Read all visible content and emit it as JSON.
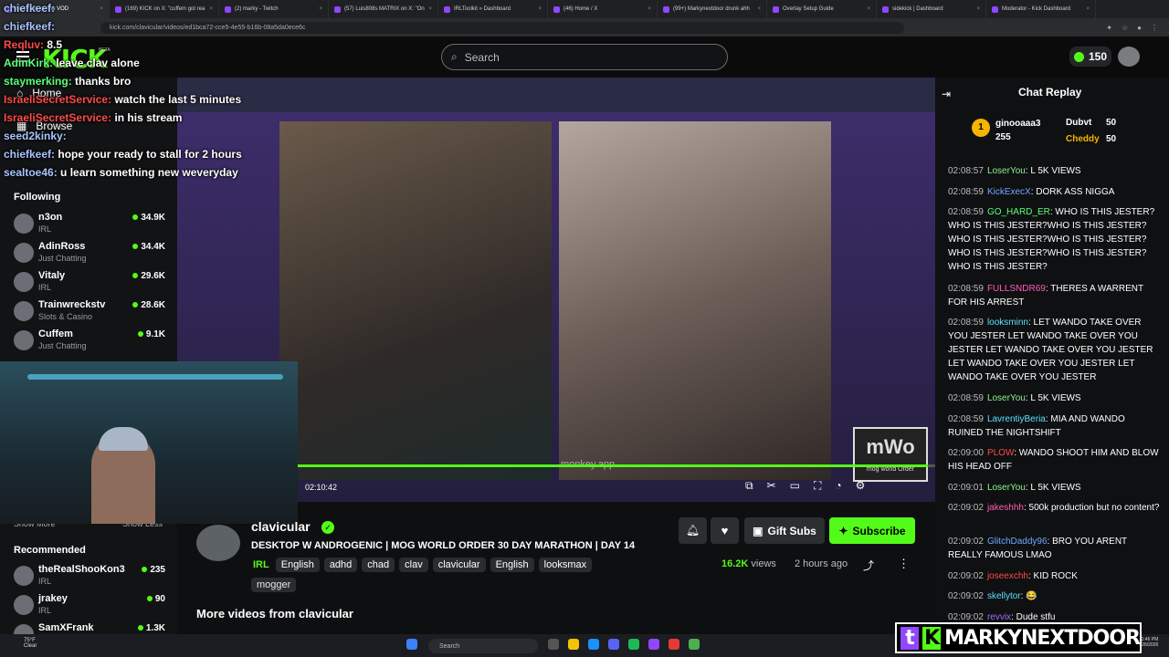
{
  "browser": {
    "tabs": [
      {
        "label": "Kick - Watch the VOD"
      },
      {
        "label": "(169) KICK on X: \"cuffem got rea"
      },
      {
        "label": "(2) marky - Twitch"
      },
      {
        "label": "(57) Luis808s MATRIX on X: \"On"
      },
      {
        "label": "IRLToolkit » Dashboard"
      },
      {
        "label": "(46) Home / X"
      },
      {
        "label": "(99+) Markynextdoor drunk ahh"
      },
      {
        "label": "Overlay Setup Guide"
      },
      {
        "label": "sidekick | Dashboard"
      },
      {
        "label": "Moderator - Kick Dashboard"
      }
    ],
    "url": "kick.com/clavicular/videos/ed1bca72-cce5-4e55-b16b-08a5da0ece6c"
  },
  "header": {
    "logo": "KICK",
    "beta": "BETA",
    "search_placeholder": "Search",
    "coins": "150"
  },
  "sidebar": {
    "home": "Home",
    "browse": "Browse",
    "following_title": "Following",
    "following": [
      {
        "name": "n3on",
        "category": "IRL",
        "viewers": "34.9K"
      },
      {
        "name": "AdinRoss",
        "category": "Just Chatting",
        "viewers": "34.4K"
      },
      {
        "name": "Vitaly",
        "category": "IRL",
        "viewers": "29.6K"
      },
      {
        "name": "Trainwreckstv",
        "category": "Slots & Casino",
        "viewers": "28.6K"
      },
      {
        "name": "Cuffem",
        "category": "Just Chatting",
        "viewers": "9.1K"
      }
    ],
    "show_more": "Show More",
    "show_less": "Show Less",
    "recommended_title": "Recommended",
    "recommended": [
      {
        "name": "theRealShooKon3",
        "category": "IRL",
        "viewers": "235"
      },
      {
        "name": "jrakey",
        "category": "IRL",
        "viewers": "90"
      },
      {
        "name": "SamXFrank",
        "category": "",
        "viewers": "1.3K"
      }
    ]
  },
  "overlay_chat": [
    {
      "user": "chiefkeef:",
      "text": ""
    },
    {
      "user": "chiefkeef:",
      "text": ""
    },
    {
      "user": "Reqluv:",
      "text": "8.5"
    },
    {
      "user": "AdinKirk:",
      "text": "leave clav alone"
    },
    {
      "user": "staymerking:",
      "text": "thanks bro"
    },
    {
      "user": "IsraeliSecretService:",
      "text": "watch the last 5 minutes"
    },
    {
      "user": "IsraeliSecretService:",
      "text": "in his stream"
    },
    {
      "user": "seed2kinky:",
      "text": ""
    },
    {
      "user": "chiefkeef:",
      "text": "hope your ready to stall for 2 hours"
    },
    {
      "user": "sealtoe46:",
      "text": "u learn something new weveryday"
    }
  ],
  "player": {
    "timecode": "02:10:42",
    "overlay_text": "monkey.app",
    "mog_logo": "mWo",
    "mog_sub": "mog world Order",
    "progress_fraction": 0.98
  },
  "video": {
    "channel": "clavicular",
    "title": "DESKTOP W ANDROGENIC | MOG WORLD ORDER 30 DAY MARATHON | DAY 14",
    "category": "IRL",
    "tags": [
      "English",
      "adhd",
      "chad",
      "clav",
      "clavicular",
      "English",
      "looksmax",
      "mogger"
    ],
    "views_count": "16.2K",
    "views_label": "views",
    "ago": "2 hours ago",
    "gift_subs": "Gift Subs",
    "subscribe": "Subscribe",
    "more_videos": "More videos from clavicular"
  },
  "chat": {
    "title": "Chat Replay",
    "leaderboard": [
      {
        "rank": "1",
        "name": "ginooaaa3",
        "value": "255"
      },
      {
        "rank": "",
        "name": "Dubvt",
        "value": "50"
      },
      {
        "rank": "",
        "name": "Cheddy",
        "value": "50"
      }
    ],
    "messages": [
      {
        "time": "02:08:57",
        "user": "LoserYou",
        "color": "#8af58a",
        "text": "L 5K VIEWS"
      },
      {
        "time": "02:08:59",
        "user": "KickExecX",
        "color": "#6fa8ff",
        "text": "DORK ASS NIGGA"
      },
      {
        "time": "02:08:59",
        "user": "GO_HARD_ER",
        "color": "#5dff7a",
        "text": "WHO IS THIS JESTER? WHO IS THIS JESTER?WHO IS THIS JESTER? WHO IS THIS JESTER?WHO IS THIS JESTER? WHO IS THIS JESTER?WHO IS THIS JESTER? WHO IS THIS JESTER?"
      },
      {
        "time": "02:08:59",
        "user": "FULLSNDR69",
        "color": "#ff5cb8",
        "text": "THERES A WARRENT FOR HIS ARREST"
      },
      {
        "time": "02:08:59",
        "user": "looksminn",
        "color": "#5ee0ff",
        "text": "LET WANDO TAKE OVER YOU JESTER LET WANDO TAKE OVER YOU JESTER LET WANDO TAKE OVER YOU JESTER LET WANDO TAKE OVER YOU JESTER LET WANDO TAKE OVER YOU JESTER"
      },
      {
        "time": "02:08:59",
        "user": "LoserYou",
        "color": "#8af58a",
        "text": "L 5K VIEWS"
      },
      {
        "time": "02:08:59",
        "user": "LavrentiyBeria",
        "color": "#5ee0ff",
        "text": "MIA AND WANDO RUINED THE NIGHTSHIFT"
      },
      {
        "time": "02:09:00",
        "user": "PLOW",
        "color": "#ff4a4a",
        "text": "WANDO SHOOT HIM AND BLOW HIS HEAD OFF"
      },
      {
        "time": "02:09:01",
        "user": "LoserYou",
        "color": "#8af58a",
        "text": "L 5K VIEWS"
      },
      {
        "time": "02:09:02",
        "user": "jakeshhh",
        "color": "#ff5cb8",
        "text": "500k production but no content?"
      },
      {
        "time": "02:09:02",
        "user": "GlitchDaddy96",
        "color": "#6fa8ff",
        "text": "BRO YOU ARENT REALLY FAMOUS LMAO"
      },
      {
        "time": "02:09:02",
        "user": "joseexchh",
        "color": "#ff4a4a",
        "text": "KID ROCK"
      },
      {
        "time": "02:09:02",
        "user": "skellytor",
        "color": "#5ee0ff",
        "text": "😂"
      },
      {
        "time": "02:09:02",
        "user": "revvix",
        "color": "#a070ff",
        "text": "Dude stfu"
      }
    ]
  },
  "taskbar": {
    "temp": "75°F",
    "weather": "Clear",
    "search": "Search",
    "time": "1:46 PM",
    "date": "5/26/2026"
  },
  "watermark": "MARKYNEXTDOOR",
  "colors": {
    "kick_green": "#53fc18",
    "background": "#0e0f11"
  }
}
